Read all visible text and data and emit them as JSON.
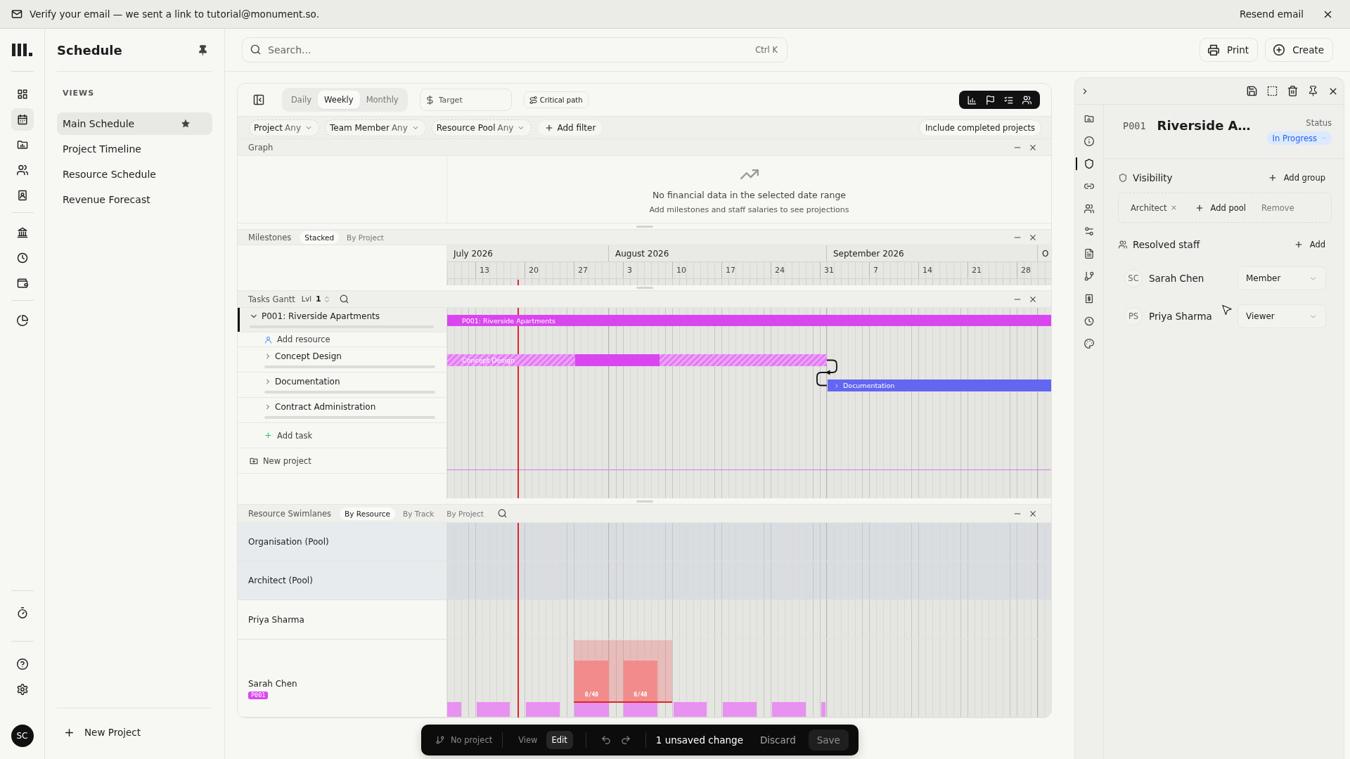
{
  "banner": {
    "message": "Verify your email — we sent a link to tutorial@monument.so.",
    "action": "Resend email"
  },
  "nav_rail": {
    "top": [
      [
        {
          "selected": false
        },
        {
          "selected": true
        },
        {
          "selected": false
        },
        {
          "selected": false
        },
        {
          "selected": false
        }
      ],
      [
        {
          "selected": false
        },
        {
          "selected": false
        },
        {
          "selected": false
        }
      ],
      [
        {
          "selected": false
        }
      ]
    ],
    "bottom": [
      [
        {
          "selected": false
        }
      ],
      [
        {
          "selected": false
        },
        {
          "selected": false
        }
      ]
    ],
    "avatar": "SC"
  },
  "sidebar": {
    "title": "Schedule",
    "section": "VIEWS",
    "items": [
      {
        "label": "Main Schedule",
        "selected": true,
        "starred": true
      },
      {
        "label": "Project Timeline",
        "selected": false,
        "starred": false
      },
      {
        "label": "Resource Schedule",
        "selected": false,
        "starred": false
      },
      {
        "label": "Revenue Forecast",
        "selected": false,
        "starred": false
      }
    ],
    "new_project": "New Project"
  },
  "header": {
    "search": {
      "placeholder": "Search...",
      "shortcut": "Ctrl K"
    },
    "buttons": [
      {
        "kind": "print",
        "label": "Print"
      },
      {
        "kind": "create",
        "label": "Create"
      }
    ]
  },
  "toolbar": {
    "ranges": [
      {
        "label": "Daily",
        "selected": false
      },
      {
        "label": "Weekly",
        "selected": true
      },
      {
        "label": "Monthly",
        "selected": false
      }
    ],
    "target": {
      "placeholder": "Target"
    },
    "critical_path": "Critical path",
    "view_toggles": [
      {
        "on": true
      },
      {
        "on": true
      },
      {
        "on": true
      },
      {
        "on": true
      }
    ]
  },
  "filters": {
    "chips": [
      {
        "label": "Project",
        "value": "Any"
      },
      {
        "label": "Team Member",
        "value": "Any"
      },
      {
        "label": "Resource Pool",
        "value": "Any"
      }
    ],
    "add_filter": "Add filter",
    "include_completed": "Include completed projects"
  },
  "graph": {
    "title": "Graph",
    "empty_title": "No financial data in the selected date range",
    "empty_hint": "Add milestones and staff salaries to see projections"
  },
  "milestones": {
    "title": "Milestones",
    "modes": [
      {
        "label": "Stacked",
        "selected": true
      },
      {
        "label": "By Project",
        "selected": false
      }
    ],
    "timeline": {
      "months": [
        "July 2026",
        "August 2026",
        "September 2026",
        "O"
      ],
      "weeks": [
        "13",
        "20",
        "27",
        "3",
        "10",
        "17",
        "24",
        "31",
        "7",
        "14",
        "21",
        "28"
      ]
    }
  },
  "tasks_gantt": {
    "title": "Tasks Gantt",
    "depth_label": "Lvl",
    "depth_value": "1",
    "rows": [
      {
        "kind": "project",
        "label": "P001: Riverside Apartments",
        "expanded": true,
        "selected": true,
        "bar": {
          "kind": "solid",
          "label": "P001: Riverside Apartments",
          "color": "#d946ef",
          "has_children": false
        }
      },
      {
        "kind": "resource",
        "label": "Add resource"
      },
      {
        "kind": "task",
        "label": "Concept Design",
        "expanded": false,
        "selected": false,
        "bar": {
          "kind": "hatched",
          "label": "Concept Design",
          "color": "#d946ef",
          "has_children": false
        }
      },
      {
        "kind": "task",
        "label": "Documentation",
        "expanded": false,
        "selected": false,
        "bar": {
          "kind": "solid",
          "label": "Documentation",
          "color": "#6366f1",
          "has_children": true
        }
      },
      {
        "kind": "task",
        "label": "Contract Administration",
        "expanded": false,
        "selected": false
      },
      {
        "kind": "add",
        "label": "Add task"
      },
      {
        "kind": "new",
        "label": "New project"
      }
    ]
  },
  "resource_swimlanes": {
    "title": "Resource Swimlanes",
    "modes": [
      {
        "label": "By Resource",
        "selected": true
      },
      {
        "label": "By Track",
        "selected": false
      },
      {
        "label": "By Project",
        "selected": false
      }
    ],
    "lanes": [
      {
        "kind": "pool",
        "label": "Organisation (Pool)",
        "booked": false
      },
      {
        "kind": "pool",
        "label": "Architect (Pool)",
        "booked": false
      },
      {
        "kind": "person",
        "label": "Priya Sharma",
        "booked": false
      },
      {
        "kind": "person",
        "label": "Sarah Chen",
        "booked": true,
        "tag": {
          "label": "P001",
          "color": "#d946ef"
        },
        "overloads": [
          "0/40",
          "0/40"
        ]
      }
    ]
  },
  "action_bar": {
    "project": "No project",
    "modes": [
      {
        "label": "View",
        "selected": false
      },
      {
        "label": "Edit",
        "selected": true
      }
    ],
    "status": "1 unsaved change",
    "discard": "Discard",
    "save": "Save"
  },
  "detail_panel": {
    "tabs": [
      {
        "selected": false
      },
      {
        "selected": false
      },
      {
        "selected": true
      },
      {
        "selected": false
      },
      {
        "selected": false
      },
      {
        "selected": false
      },
      {
        "selected": false
      },
      {
        "selected": false
      },
      {
        "selected": false
      },
      {
        "selected": false
      },
      {
        "selected": false
      }
    ],
    "code": "P001",
    "title": "Riverside A…",
    "status_label": "Status",
    "status": "In Progress",
    "visibility": {
      "title": "Visibility",
      "add_group": "Add group",
      "groups": [
        {
          "label": "Architect"
        }
      ],
      "add_pool": "Add pool",
      "remove": "Remove"
    },
    "staff": {
      "title": "Resolved staff",
      "add": "Add",
      "members": [
        {
          "initials": "SC",
          "name": "Sarah Chen",
          "role": "Member"
        },
        {
          "initials": "PS",
          "name": "Priya Sharma",
          "role": "Viewer"
        }
      ]
    }
  }
}
